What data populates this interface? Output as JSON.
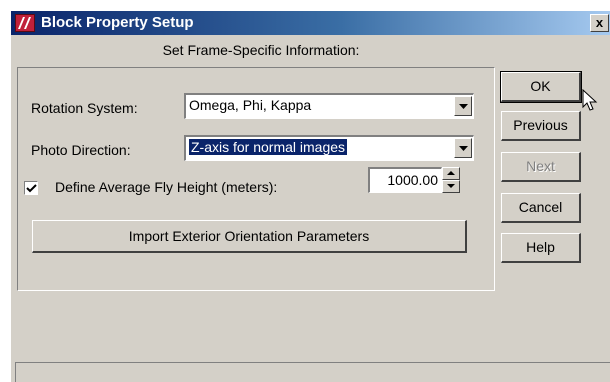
{
  "window": {
    "title": "Block Property Setup",
    "close_label": "x",
    "subtitle": "Set Frame-Specific Information:"
  },
  "form": {
    "rotation_system": {
      "label": "Rotation System:",
      "value": "Omega, Phi, Kappa"
    },
    "photo_direction": {
      "label": "Photo Direction:",
      "value": "Z-axis for normal images"
    },
    "fly_height": {
      "label": "Define Average Fly Height (meters):",
      "checked": true,
      "value": "1000.00"
    },
    "import_button": "Import Exterior Orientation Parameters"
  },
  "buttons": {
    "ok": "OK",
    "previous": "Previous",
    "next": "Next",
    "cancel": "Cancel",
    "help": "Help"
  },
  "icons": [
    "app-icon",
    "close-icon",
    "dropdown-arrow-icon",
    "checkmark-icon",
    "spin-up-icon",
    "spin-down-icon",
    "mouse-cursor-icon"
  ]
}
